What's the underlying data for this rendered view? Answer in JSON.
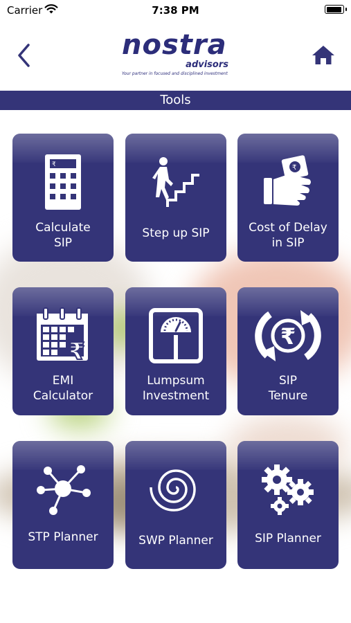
{
  "status_bar": {
    "carrier": "Carrier",
    "time": "7:38 PM",
    "battery_level": 0.95
  },
  "header": {
    "logo": {
      "brand": "nostra",
      "sub": "advisors",
      "tagline": "Your partner in focused and disciplined investment"
    },
    "back_icon": "chevron-left-icon",
    "home_icon": "home-icon"
  },
  "title": "Tools",
  "tools": [
    {
      "label": "Calculate\nSIP",
      "icon": "calculator-icon"
    },
    {
      "label": "Step up SIP",
      "icon": "stairs-climb-icon"
    },
    {
      "label": "Cost of Delay\nin SIP",
      "icon": "hand-money-icon"
    },
    {
      "label": "EMI\nCalculator",
      "icon": "calendar-rupee-icon"
    },
    {
      "label": "Lumpsum\nInvestment",
      "icon": "weighing-scale-icon"
    },
    {
      "label": "SIP\nTenure",
      "icon": "rupee-cycle-icon"
    },
    {
      "label": "STP Planner",
      "icon": "network-hub-icon"
    },
    {
      "label": "SWP Planner",
      "icon": "spiral-icon"
    },
    {
      "label": "SIP Planner",
      "icon": "gears-icon"
    }
  ],
  "colors": {
    "primary": "#343478",
    "brand": "#2c2d7a",
    "text_on_primary": "#ffffff"
  }
}
